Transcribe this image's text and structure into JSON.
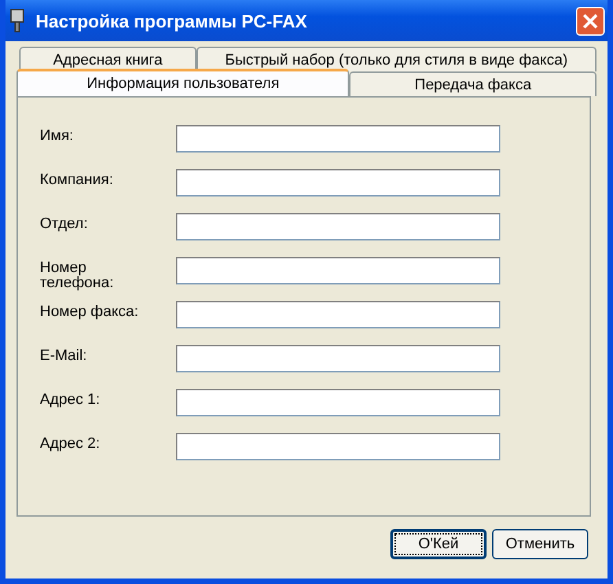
{
  "window": {
    "title": "Настройка программы PC-FAX"
  },
  "tab_rows": [
    [
      {
        "label": "Адресная книга",
        "selected": false
      },
      {
        "label": "Быстрый набор (только для стиля в виде факса)",
        "selected": false
      }
    ],
    [
      {
        "label": "Информация пользователя",
        "selected": true
      },
      {
        "label": "Передача факса",
        "selected": false
      }
    ]
  ],
  "fields": [
    {
      "label": "Имя:"
    },
    {
      "label": "Компания:"
    },
    {
      "label": "Отдел:"
    },
    {
      "label": "Номер телефона:"
    },
    {
      "label": "Номер факса:"
    },
    {
      "label": "E-Mail:"
    },
    {
      "label": "Адрес 1:"
    },
    {
      "label": "Адрес 2:"
    }
  ],
  "buttons": [
    {
      "label": "O'Кей",
      "focused": true
    },
    {
      "label": "Отменить",
      "focused": false
    }
  ]
}
